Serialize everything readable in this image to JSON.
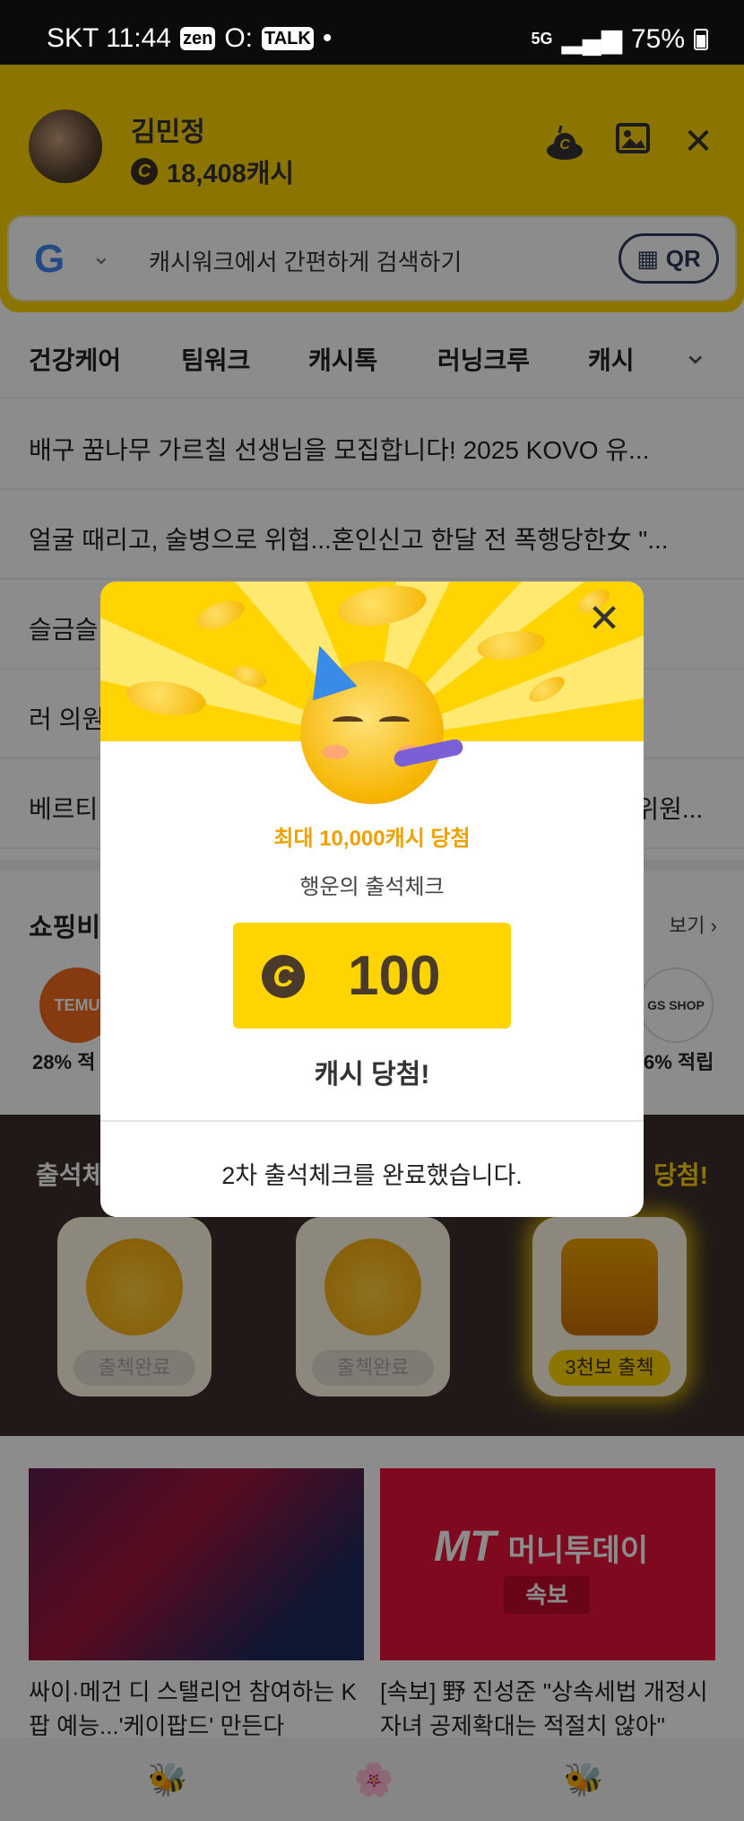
{
  "status_bar": {
    "carrier_time": "SKT 11:44",
    "icons": [
      "zen-icon",
      "o-icon",
      "talk-icon",
      "dot-icon"
    ],
    "network": "5G",
    "battery": "75%"
  },
  "profile": {
    "name": "김민정",
    "cash": "18,408캐시"
  },
  "search": {
    "placeholder": "캐시워크에서 간편하게 검색하기",
    "qr_label": "QR"
  },
  "tabs": [
    "건강케어",
    "팀워크",
    "캐시톡",
    "러닝크루",
    "캐시"
  ],
  "news": [
    "배구 꿈나무 가르칠 선생님을 모집합니다! 2025 KOVO 유...",
    "얼굴 때리고, 술병으로 위협...혼인신고 한달 전 폭행당한女 \"...",
    "슬금슬",
    "러 의원",
    "베르티",
    "-위원..."
  ],
  "shopping": {
    "title": "쇼핑비",
    "more": "보기",
    "rate_left": "28% 적",
    "rate_right": "6% 적립",
    "logo_left": "TEMU",
    "logo_right": "GS SHOP"
  },
  "attendance": {
    "title": "출석체",
    "prize": "당첨!",
    "cards": [
      {
        "label": "출첵완료"
      },
      {
        "label": "출첵완료"
      },
      {
        "label": "3천보 출첵"
      }
    ]
  },
  "bottom_news": [
    {
      "caption": "싸이·메건 디 스탤리언 참여하는 K팝 예능...'케이팝드' 만든다"
    },
    {
      "caption": "[속보] 野 진성준 \"상속세법 개정시 자녀 공제확대는 적절치 않아\"",
      "logo": "MT",
      "logo_text": "머니투데이",
      "badge": "속보"
    }
  ],
  "modal": {
    "headline": "최대 10,000캐시 당첨",
    "subtitle": "행운의 출석체크",
    "amount": "100",
    "win_text": "캐시 당첨!",
    "footer": "2차 출석체크를 완료했습니다."
  },
  "colors": {
    "brand_yellow": "#ffd400",
    "dark_brown": "#3b2f2a",
    "accent_orange": "#f0a000"
  }
}
